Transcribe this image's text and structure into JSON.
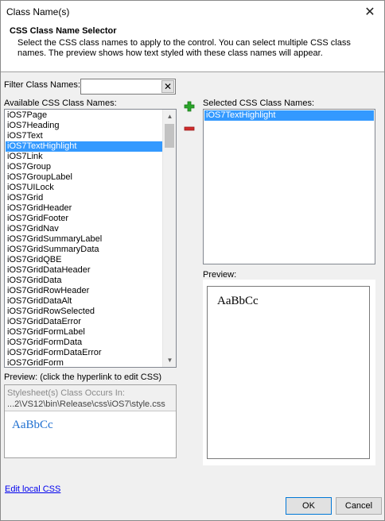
{
  "window": {
    "title": "Class Name(s)",
    "close_glyph": "✕"
  },
  "header": {
    "title": "CSS Class Name Selector",
    "description": "Select the CSS class names to apply to the control. You can select multiple CSS class names. The preview shows how text styled with these class names will appear."
  },
  "filter": {
    "label": "Filter Class Names:",
    "value": "",
    "clear_glyph": "✕"
  },
  "available": {
    "label": "Available CSS Class Names:",
    "selected_index": 3,
    "items": [
      "iOS7Page",
      "iOS7Heading",
      "iOS7Text",
      "iOS7TextHighlight",
      "iOS7Link",
      "iOS7Group",
      "iOS7GroupLabel",
      "iOS7UILock",
      "iOS7Grid",
      "iOS7GridHeader",
      "iOS7GridFooter",
      "iOS7GridNav",
      "iOS7GridSummaryLabel",
      "iOS7GridSummaryData",
      "iOS7GridQBE",
      "iOS7GridDataHeader",
      "iOS7GridData",
      "iOS7GridRowHeader",
      "iOS7GridDataAlt",
      "iOS7GridRowSelected",
      "iOS7GridDataError",
      "iOS7GridFormLabel",
      "iOS7GridFormData",
      "iOS7GridFormDataError",
      "iOS7GridForm"
    ]
  },
  "selected": {
    "label": "Selected CSS Class Names:",
    "items": [
      "iOS7TextHighlight"
    ]
  },
  "preview_left": {
    "label": "Preview: (click the hyperlink to edit CSS)",
    "occurs_label": "Stylesheet(s) Class Occurs In:",
    "occurs_path": "...2\\VS12\\bin\\Release\\css\\iOS7\\style.css",
    "sample": "AaBbCc"
  },
  "preview_right": {
    "label": "Preview:",
    "sample": "AaBbCc"
  },
  "footer": {
    "edit_link": "Edit local CSS",
    "ok": "OK",
    "cancel": "Cancel"
  },
  "icons": {
    "add": "plus-icon",
    "remove": "minus-icon",
    "add_color": "#2aa52a",
    "remove_color": "#d02b2b"
  }
}
